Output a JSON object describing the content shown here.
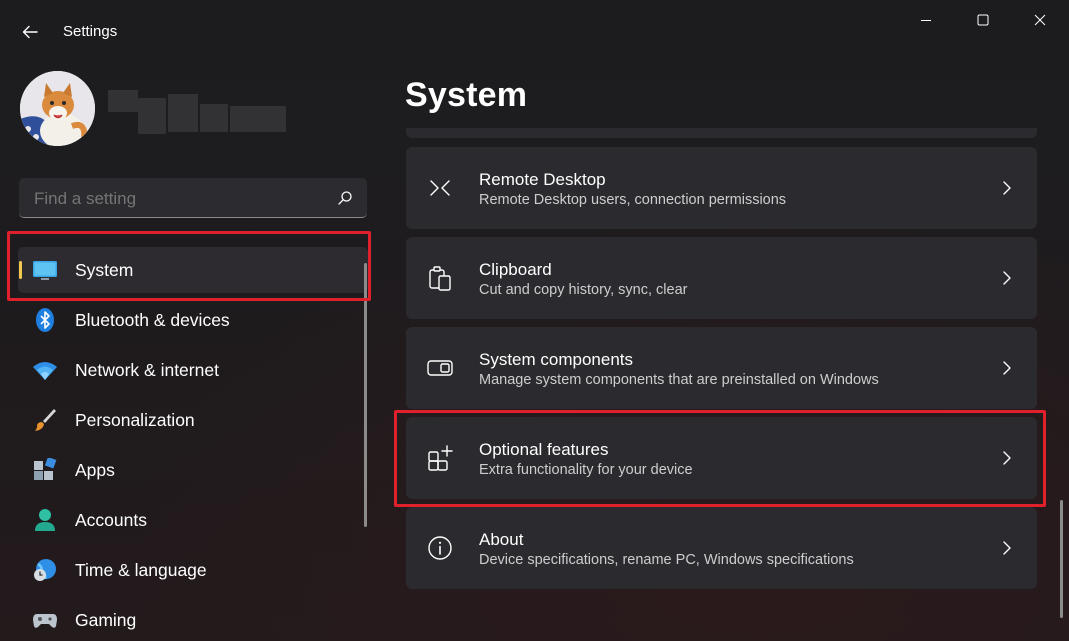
{
  "titlebar": {
    "app_title": "Settings"
  },
  "search": {
    "placeholder": "Find a setting"
  },
  "nav": {
    "items": [
      {
        "label": "System",
        "selected": true
      },
      {
        "label": "Bluetooth & devices"
      },
      {
        "label": "Network & internet"
      },
      {
        "label": "Personalization"
      },
      {
        "label": "Apps"
      },
      {
        "label": "Accounts"
      },
      {
        "label": "Time & language"
      },
      {
        "label": "Gaming"
      }
    ]
  },
  "main": {
    "title": "System",
    "cards": [
      {
        "title": "Remote Desktop",
        "subtitle": "Remote Desktop users, connection permissions",
        "icon": "remote-desktop-icon"
      },
      {
        "title": "Clipboard",
        "subtitle": "Cut and copy history, sync, clear",
        "icon": "clipboard-icon"
      },
      {
        "title": "System components",
        "subtitle": "Manage system components that are preinstalled on Windows",
        "icon": "system-components-icon"
      },
      {
        "title": "Optional features",
        "subtitle": "Extra functionality for your device",
        "icon": "optional-features-icon"
      },
      {
        "title": "About",
        "subtitle": "Device specifications, rename PC, Windows specifications",
        "icon": "info-icon"
      }
    ]
  },
  "colors": {
    "accent_indicator": "#f2c94c",
    "highlight_box": "#e0202a",
    "card_bg": "#2b2a2f"
  }
}
